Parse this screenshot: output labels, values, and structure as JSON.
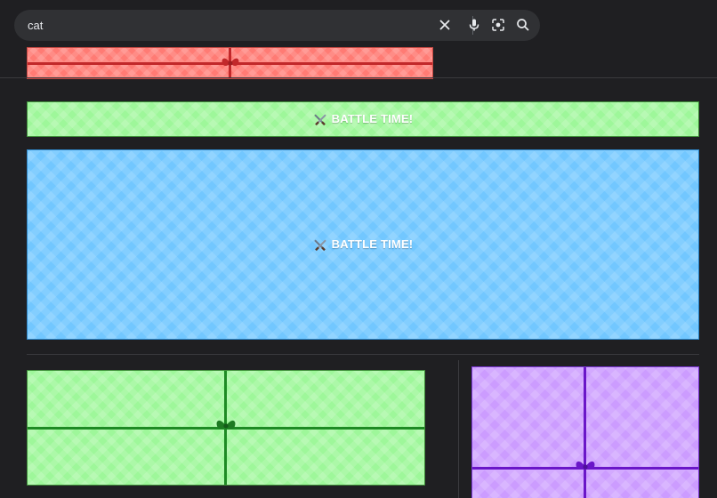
{
  "search": {
    "query": "cat",
    "icons": [
      "clear-icon",
      "microphone-icon",
      "lens-icon",
      "search-icon"
    ]
  },
  "tiles": {
    "red_gift": {
      "color": "#ff7b74",
      "ribbon": "#c2282a"
    },
    "green_banner": {
      "text": "BATTLE TIME!",
      "icon": "crossed-swords-icon",
      "color": "#9ef79a"
    },
    "blue_banner": {
      "text": "BATTLE TIME!",
      "icon": "crossed-swords-icon",
      "color": "#72c7ff"
    },
    "green_gift": {
      "color": "#9ef79a",
      "ribbon": "#1e8a24"
    },
    "purple_gift": {
      "color": "#cc9cff",
      "ribbon": "#6a16c8"
    }
  }
}
